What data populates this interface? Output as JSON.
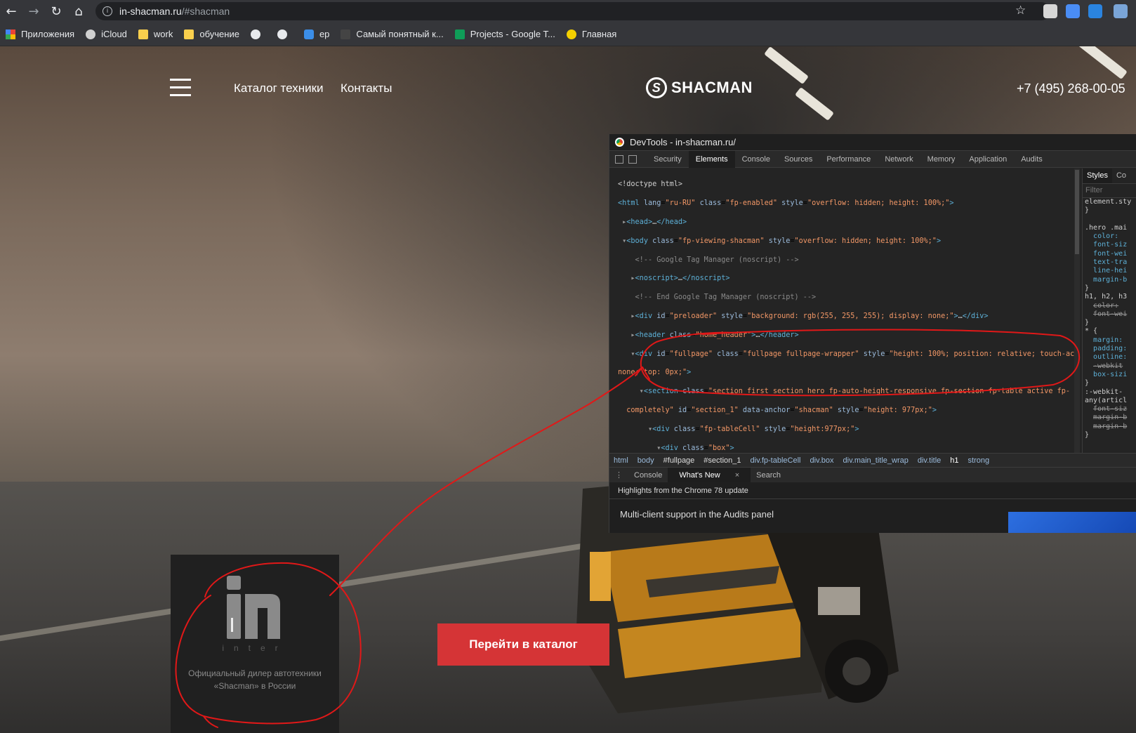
{
  "browser": {
    "url_host": "in-shacman.ru",
    "url_path": "/#shacman",
    "bookmarks": [
      {
        "label": "Приложения",
        "icon": "apps-grid-icon"
      },
      {
        "label": "iCloud",
        "icon": "apple-icon"
      },
      {
        "label": "work",
        "icon": "folder-icon"
      },
      {
        "label": "обучение",
        "icon": "folder-icon"
      },
      {
        "label": "",
        "icon": "globe-icon"
      },
      {
        "label": "",
        "icon": "globe-icon"
      },
      {
        "label": "ep",
        "icon": "site-icon"
      },
      {
        "label": "Самый понятный к...",
        "icon": "site-icon"
      },
      {
        "label": "Projects - Google T...",
        "icon": "google-sheets-icon"
      },
      {
        "label": "Главная",
        "icon": "site-icon"
      }
    ]
  },
  "site": {
    "nav": {
      "catalog": "Каталог техники",
      "contacts": "Контакты"
    },
    "logo_text": "SHACMAN",
    "phone": "+7 (495) 268-00-05",
    "box": {
      "inter_text": "inter",
      "description": "Официальный дилер автотехники «Shacman» в России"
    },
    "cta": "Перейти в каталог",
    "accent_color": "#d53436"
  },
  "devtools": {
    "title": "DevTools - in-shacman.ru/",
    "tabs": [
      "Security",
      "Elements",
      "Console",
      "Sources",
      "Performance",
      "Network",
      "Memory",
      "Application",
      "Audits"
    ],
    "active_tab": "Elements",
    "styles_tabs": [
      "Styles",
      "Co"
    ],
    "styles_filter": "Filter",
    "breadcrumbs": [
      "html",
      "body",
      "#fullpage",
      "#section_1",
      "div.fp-tableCell",
      "div.box",
      "div.main_title_wrap",
      "div.title",
      "h1",
      "strong"
    ],
    "drawer_tabs": [
      "Console",
      "What's New",
      "Search"
    ],
    "drawer_highlight": "Highlights from the Chrome 78 update",
    "drawer_item": "Multi-client support in the Audits panel"
  }
}
